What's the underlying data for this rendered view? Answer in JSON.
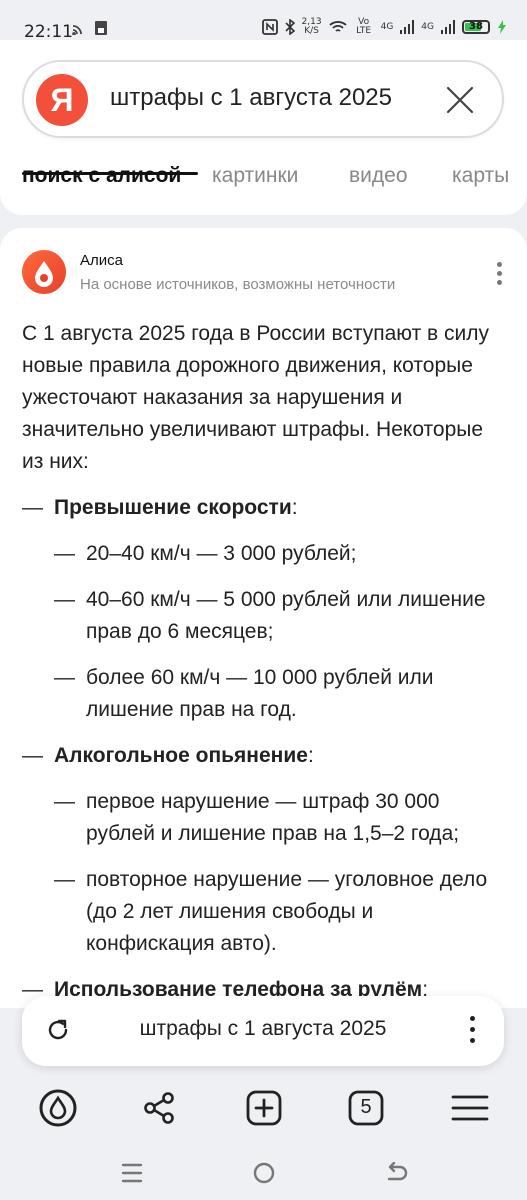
{
  "status_bar": {
    "time": "22:11",
    "speed_value": "2,13",
    "speed_unit": "K/S",
    "volte": "Vo LTE",
    "net1": "4G",
    "net2": "4G",
    "battery": "38"
  },
  "search": {
    "logo": "Я",
    "query": "штрафы с 1 августа 2025"
  },
  "tabs": [
    "поиск с алисой",
    "картинки",
    "видео",
    "карты"
  ],
  "alisa": {
    "name": "Алиса",
    "subtitle": "На основе источников, возможны неточности",
    "intro": "С 1 августа 2025 года в России вступают в силу новые правила дорожного движения, которые ужесточают наказания за нарушения и значительно увеличивают штрафы. Некоторые из них:",
    "section1_title": "Превышение скорости",
    "section1_items": [
      "20–40 км/ч — 3 000 рублей;",
      "40–60 км/ч — 5 000 рублей или лишение прав до 6 месяцев;",
      "более 60 км/ч — 10 000 рублей или лишение прав на год."
    ],
    "section2_title": "Алкогольное опьянение",
    "section2_items": [
      "первое нарушение — штраф 30 000 рублей и лишение прав на 1,5–2 года;",
      "повторное нарушение — уголовное дело (до 2 лет лишения свободы и конфискация авто)."
    ],
    "section3_title": "Использование телефона за рулём"
  },
  "bottom_query": "штрафы с 1 августа 2025",
  "tab_count": "5",
  "colors": {
    "yandex_red": "#f2503a",
    "alisa_gradient": "#e8402a",
    "battery_green": "#37c24c"
  },
  "icons": [
    "search-clear-icon",
    "refresh-icon",
    "more-icon",
    "alice-icon",
    "share-icon",
    "new-tab-icon",
    "tabs-icon",
    "menu-icon"
  ]
}
